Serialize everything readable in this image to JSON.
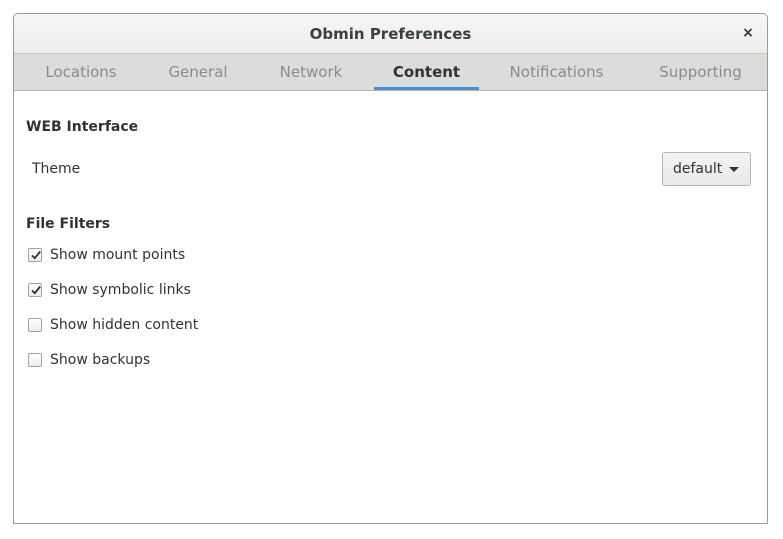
{
  "window": {
    "title": "Obmin Preferences",
    "close_glyph": "×"
  },
  "tabs": [
    {
      "label": "Locations",
      "active": false
    },
    {
      "label": "General",
      "active": false
    },
    {
      "label": "Network",
      "active": false
    },
    {
      "label": "Content",
      "active": true
    },
    {
      "label": "Notifications",
      "active": false
    },
    {
      "label": "Supporting",
      "active": false
    }
  ],
  "web_interface": {
    "title": "WEB Interface",
    "theme_label": "Theme",
    "theme_value": "default"
  },
  "file_filters": {
    "title": "File Filters",
    "items": [
      {
        "label": "Show mount points",
        "checked": true
      },
      {
        "label": "Show symbolic links",
        "checked": true
      },
      {
        "label": "Show hidden content",
        "checked": false
      },
      {
        "label": "Show backups",
        "checked": false
      }
    ]
  },
  "colors": {
    "accent": "#4a90d9"
  }
}
